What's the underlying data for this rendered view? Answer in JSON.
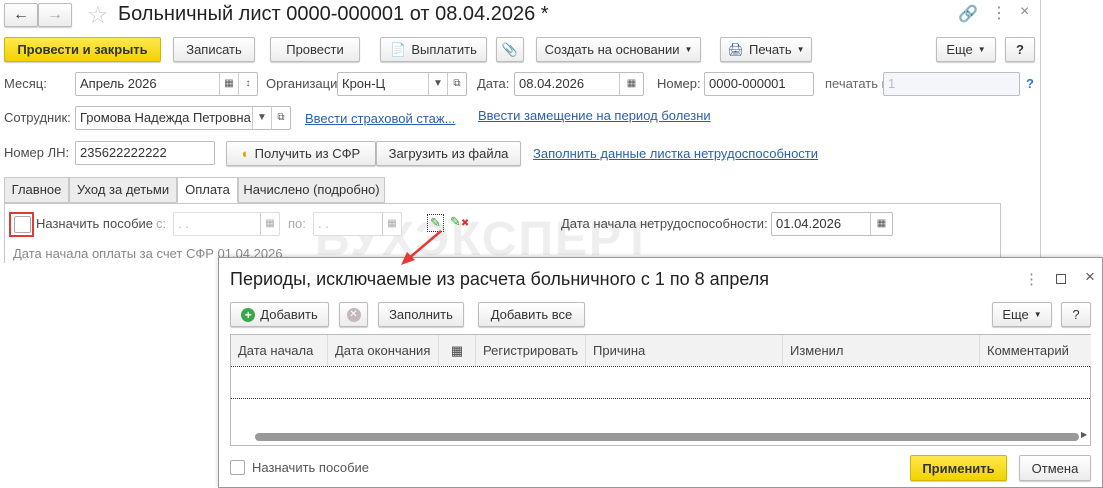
{
  "window": {
    "title": "Больничный лист 0000-000001 от 08.04.2026 *"
  },
  "toolbar": {
    "post_close": "Провести и закрыть",
    "save": "Записать",
    "post": "Провести",
    "pay": "Выплатить",
    "create_based": "Создать на основании",
    "print": "Печать",
    "more": "Еще",
    "help": "?"
  },
  "form": {
    "month_label": "Месяц:",
    "month_value": "Апрель 2026",
    "org_label": "Организация:",
    "org_value": "Крон-Ц",
    "date_label": "Дата:",
    "date_value": "08.04.2026",
    "number_label": "Номер:",
    "number_value": "0000-000001",
    "print_as_label": "печатать как:",
    "print_as_value": "1",
    "print_as_help": "?",
    "employee_label": "Сотрудник:",
    "employee_value": "Громова Надежда Петровна",
    "insurance_link": "Ввести страховой стаж...",
    "replacement_link": "Ввести замещение на период болезни",
    "ln_label": "Номер ЛН:",
    "ln_value": "235622222222",
    "get_sfr": "Получить из СФР",
    "load_file": "Загрузить из файла",
    "fill_link": "Заполнить данные листка нетрудоспособности"
  },
  "tabs": [
    {
      "label": "Главное"
    },
    {
      "label": "Уход за детьми"
    },
    {
      "label": "Оплата",
      "active": true
    },
    {
      "label": "Начислено (подробно)"
    }
  ],
  "payment": {
    "assign_label": "Назначить пособие",
    "assign_checked": false,
    "from_label": "с:",
    "from_value": " .  .",
    "to_label": "по:",
    "to_value": " .  .",
    "start_label": "Дата начала нетрудоспособности:",
    "start_value": "01.04.2026",
    "sfr_text": "Дата начала оплаты за счет СФР 01.04.2026"
  },
  "watermark": "БУХЭКСПЕРТ",
  "dialog": {
    "title": "Периоды, исключаемые из расчета больничного с 1 по 8 апреля",
    "add": "Добавить",
    "fill": "Заполнить",
    "add_all": "Добавить все",
    "more": "Еще",
    "help": "?",
    "columns": [
      "Дата начала",
      "Дата окончания",
      "",
      "Регистрировать",
      "Причина",
      "Изменил",
      "Комментарий"
    ],
    "assign_label": "Назначить пособие",
    "assign_checked": false,
    "apply": "Применить",
    "cancel": "Отмена"
  },
  "colors": {
    "accent_yellow": "#f1d300",
    "link": "#2a5fb0",
    "highlight": "#e53935"
  }
}
